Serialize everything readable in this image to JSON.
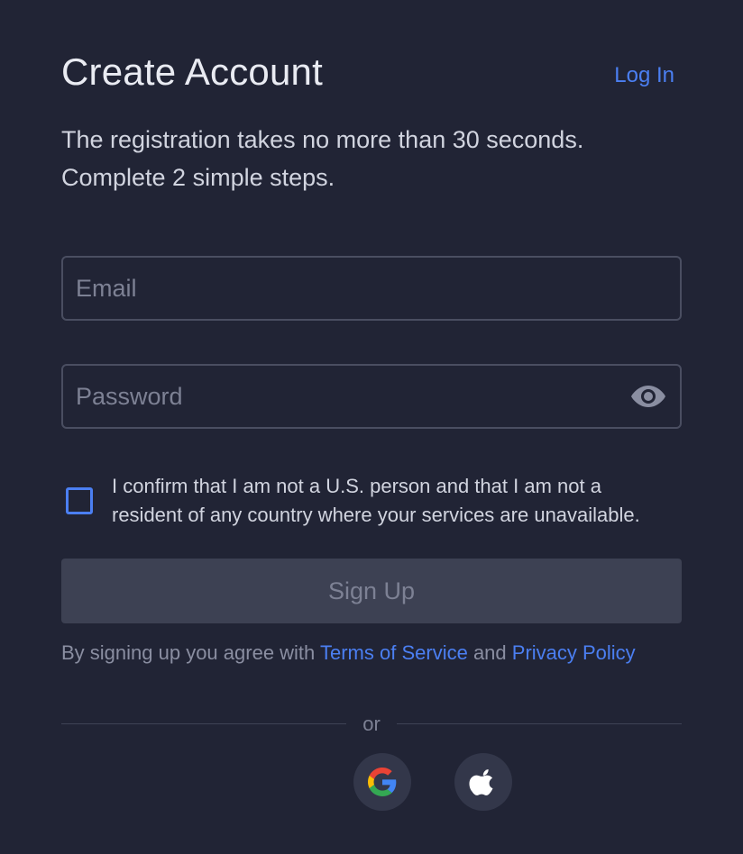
{
  "header": {
    "title": "Create Account",
    "login_label": "Log In"
  },
  "subtitle": {
    "line1": "The registration takes no more than 30 seconds.",
    "line2": "Complete 2 simple steps."
  },
  "form": {
    "email_placeholder": "Email",
    "email_value": "",
    "password_placeholder": "Password",
    "password_value": "",
    "confirm_checked": false,
    "confirm_text_line1": "I confirm that I am not a U.S. person and that I am not a",
    "confirm_text_line2": "resident of any country where your services are unavailable.",
    "signup_label": "Sign Up"
  },
  "agreement": {
    "prefix": "By signing up you agree with ",
    "terms_label": "Terms of Service",
    "conjunction": " and ",
    "privacy_label": "Privacy Policy"
  },
  "divider": {
    "label": "or"
  },
  "social": {
    "google_icon": "google-icon",
    "apple_icon": "apple-icon"
  },
  "colors": {
    "background": "#212435",
    "accent": "#4b7ff2",
    "button_disabled": "#3d4153",
    "border": "#4a4e61"
  }
}
